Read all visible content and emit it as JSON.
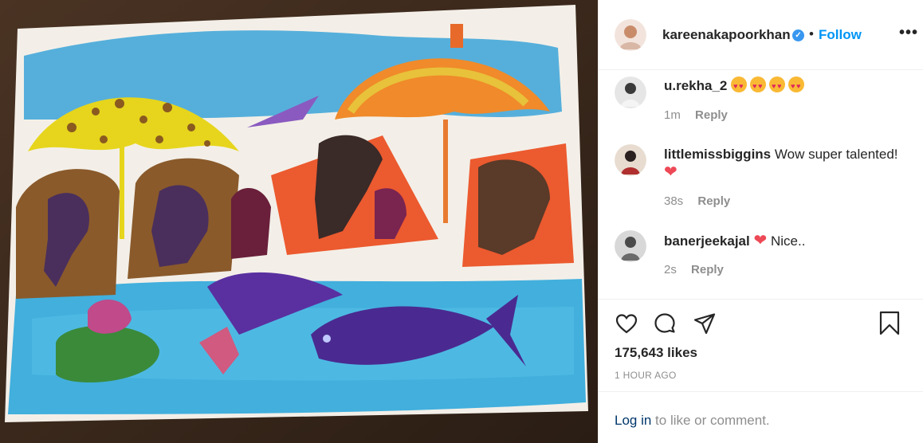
{
  "post": {
    "username": "kareenakapoorkhan",
    "separator": "•",
    "follow_label": "Follow",
    "more_label": "•••",
    "verified_icon": "verified-badge-icon"
  },
  "comments": [
    {
      "username": "u.rekha_2",
      "text": "",
      "emojis": [
        "heart-eyes-emoji",
        "heart-eyes-emoji",
        "heart-eyes-emoji",
        "heart-eyes-emoji"
      ],
      "time": "1m",
      "reply": "Reply"
    },
    {
      "username": "littlemissbiggins",
      "text": "Wow super talented!",
      "time": "38s",
      "reply": "Reply"
    },
    {
      "username": "banerjeekajal",
      "text": "Nice..",
      "time": "2s",
      "reply": "Reply"
    }
  ],
  "actions": {
    "likes": "175,643 likes",
    "posted": "1 HOUR AGO",
    "icons": [
      "heart-icon",
      "comment-icon",
      "share-icon",
      "bookmark-icon"
    ]
  },
  "login": {
    "link": "Log in",
    "rest": " to like or comment."
  },
  "colors": {
    "accent": "#0095f6",
    "verified": "#3897f0",
    "heart": "#ed4956",
    "muted": "#8e8e8e"
  }
}
